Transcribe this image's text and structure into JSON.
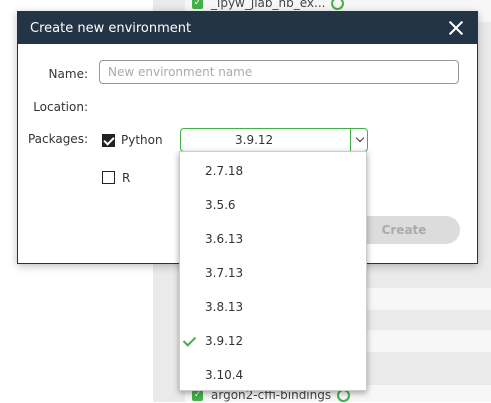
{
  "background": {
    "packages": [
      {
        "name": "_ipyw_jlab_nb_ex..."
      },
      {
        "name": "argon2-cffi-bindings"
      }
    ]
  },
  "dialog": {
    "title": "Create new environment",
    "name_label": "Name:",
    "name_placeholder": "New environment name",
    "location_label": "Location:",
    "packages_label": "Packages:",
    "python_label": "Python",
    "python_checked": true,
    "r_label": "R",
    "r_checked": false,
    "python_version_selected": "3.9.12",
    "create_label": "Create"
  },
  "dropdown": {
    "options": [
      "2.7.18",
      "3.5.6",
      "3.6.13",
      "3.7.13",
      "3.8.13",
      "3.9.12",
      "3.10.4"
    ],
    "selected": "3.9.12"
  },
  "colors": {
    "header": "#243447",
    "accent": "#43b049"
  }
}
